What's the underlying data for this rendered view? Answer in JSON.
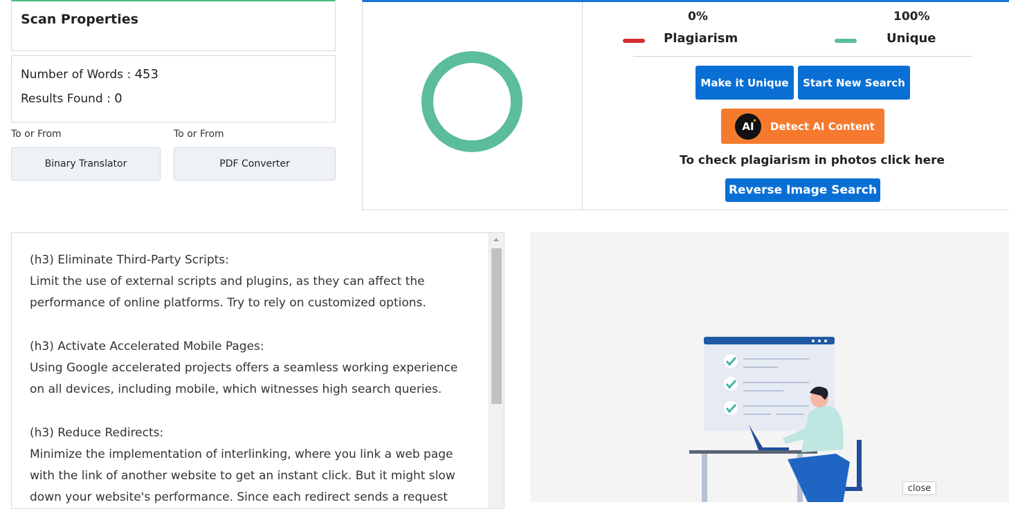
{
  "scan": {
    "title": "Scan Properties",
    "words_label": "Number of Words :",
    "words_value": "453",
    "results_label": "Results Found :",
    "results_value": "0"
  },
  "tools": [
    {
      "label": "To or From",
      "button": "Binary Translator"
    },
    {
      "label": "To or From",
      "button": "PDF Converter"
    }
  ],
  "result": {
    "plagiarism_percent": "0%",
    "unique_percent": "100%",
    "plagiarism_label": "Plagiarism",
    "unique_label": "Unique",
    "unique_fraction": 1.0,
    "colors": {
      "plagiarism": "#d32f2f",
      "unique": "#5bbd99"
    }
  },
  "actions": {
    "make_unique": "Make it Unique",
    "new_search": "Start New Search",
    "detect_ai_icon": "AI",
    "detect_ai": "Detect AI Content",
    "photo_prompt": "To check plagiarism in photos click here",
    "reverse_image": "Reverse Image Search"
  },
  "content": {
    "paragraphs": [
      [
        "(h3) Eliminate Third-Party Scripts:",
        "Limit the use of external scripts and plugins, as they can affect the",
        "performance of online platforms. Try to rely on customized options."
      ],
      [
        "(h3) Activate Accelerated Mobile Pages:",
        "Using Google accelerated projects offers a seamless working experience",
        "on all devices, including mobile, which witnesses high search queries."
      ],
      [
        "(h3) Reduce Redirects:",
        "Minimize the implementation of interlinking, where you link a web page",
        "with the link of another website to get an instant click. But it might slow",
        "down your website's performance. Since each redirect sends a request"
      ]
    ]
  },
  "ad": {
    "close_label": "close"
  }
}
